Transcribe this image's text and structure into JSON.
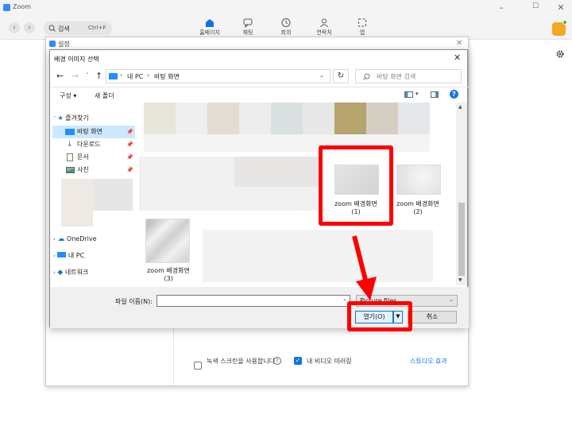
{
  "app": {
    "title": "Zoom",
    "logo_color": "#2d8cff"
  },
  "toolbar": {
    "search_placeholder": "검색",
    "search_shortcut": "Ctrl+F",
    "tabs": [
      {
        "label": "홈페이지",
        "icon": "home-icon",
        "active": true
      },
      {
        "label": "채팅",
        "icon": "chat-icon"
      },
      {
        "label": "회의",
        "icon": "clock-icon"
      },
      {
        "label": "연락처",
        "icon": "contact-icon"
      },
      {
        "label": "앱",
        "icon": "apps-icon"
      }
    ]
  },
  "settings": {
    "title": "설정",
    "green_screen_label": "녹색 스크린을 사용합니다",
    "mirror_label": "내 비디오 미러링",
    "mirror_checked": true,
    "studio_effects_link": "스튜디오 효과"
  },
  "dialog": {
    "title": "배경 이미지 선택",
    "path": [
      "내 PC",
      "바탕 화면"
    ],
    "search_placeholder": "바탕 화면 검색",
    "organize_label": "구성",
    "new_folder_label": "새 폴더",
    "quick_access": "즐겨찾기",
    "nav_items": [
      {
        "label": "바탕 화면",
        "icon": "desktop-icon"
      },
      {
        "label": "다운로드",
        "icon": "download-icon"
      },
      {
        "label": "문서",
        "icon": "document-icon"
      },
      {
        "label": "사진",
        "icon": "picture-icon"
      }
    ],
    "onedrive": "OneDrive",
    "this_pc": "내 PC",
    "network": "네트워크",
    "files": [
      {
        "name": "zoom 배경화면",
        "index": "(1)"
      },
      {
        "name": "zoom 배경화면",
        "index": "(2)"
      },
      {
        "name": "zoom 배경화면",
        "index": "(3)"
      }
    ],
    "filename_label": "파일 이름(N):",
    "filename_value": "",
    "filter_value": "Picture files",
    "open_label": "열기(O)",
    "cancel_label": "취소"
  },
  "colors": {
    "highlight": "#ff0000",
    "accent": "#0e72ed",
    "selection": "#cce8ff"
  }
}
